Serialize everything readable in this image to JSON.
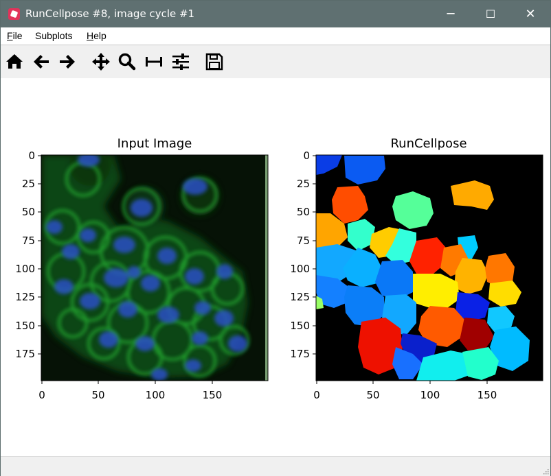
{
  "window": {
    "title": "RunCellpose #8, image cycle #1",
    "minimize": "─",
    "maximize": "☐",
    "close": "✕"
  },
  "menu": {
    "file": {
      "first": "F",
      "rest": "ile"
    },
    "subplots": "Subplots",
    "help": {
      "first": "H",
      "rest": "elp"
    }
  },
  "toolbar": [
    {
      "icon": "home-icon"
    },
    {
      "icon": "back-arrow-icon"
    },
    {
      "icon": "forward-arrow-icon"
    },
    {
      "icon": "pan-move-icon"
    },
    {
      "icon": "zoom-magnifier-icon"
    },
    {
      "icon": "subplot-spacing-icon"
    },
    {
      "icon": "configure-sliders-icon"
    },
    {
      "icon": "save-floppy-icon"
    }
  ],
  "plots": [
    {
      "title": "Input Image",
      "x_ticks": [
        "0",
        "50",
        "100",
        "150"
      ],
      "y_ticks": [
        "0",
        "25",
        "50",
        "75",
        "100",
        "125",
        "150",
        "175"
      ]
    },
    {
      "title": "RunCellpose",
      "x_ticks": [
        "0",
        "50",
        "100",
        "150"
      ],
      "y_ticks": [
        "0",
        "25",
        "50",
        "75",
        "100",
        "125",
        "150",
        "175"
      ]
    }
  ],
  "colors": {
    "titlebar": "#5f7071",
    "input_background": "#061206",
    "input_cell_green": "#1fa82a",
    "input_nucleus_blue": "#2b4fc4",
    "label_background": "#000000"
  },
  "chart_data": [
    {
      "type": "heatmap",
      "title": "Input Image",
      "xlim": [
        0,
        199
      ],
      "ylim": [
        199,
        0
      ],
      "xticks": [
        0,
        50,
        100,
        150
      ],
      "yticks": [
        0,
        25,
        50,
        75,
        100,
        125,
        150,
        175
      ]
    },
    {
      "type": "heatmap",
      "title": "RunCellpose",
      "xlim": [
        0,
        199
      ],
      "ylim": [
        199,
        0
      ],
      "xticks": [
        0,
        50,
        100,
        150
      ],
      "yticks": [
        0,
        25,
        50,
        75,
        100,
        125,
        150,
        175
      ]
    }
  ]
}
